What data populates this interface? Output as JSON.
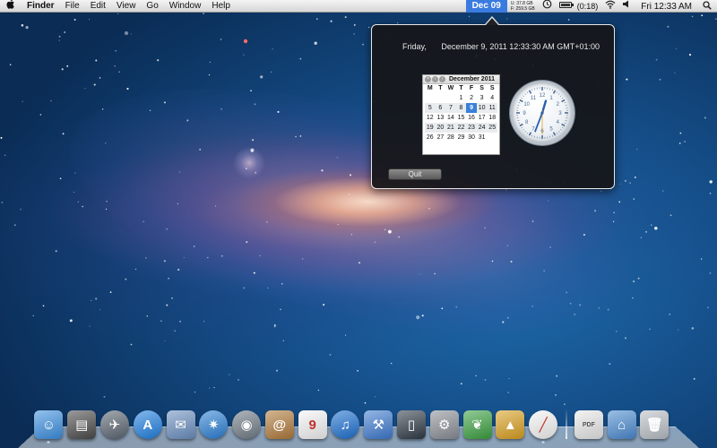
{
  "menubar": {
    "apple_icon": "apple-logo",
    "app_name": "Finder",
    "menus": [
      "File",
      "Edit",
      "View",
      "Go",
      "Window",
      "Help"
    ],
    "status_date": "Dec 09",
    "disk_stats": [
      "U:  37.8 GB",
      "F: 259.5 GB"
    ],
    "icons": [
      "time-machine-icon",
      "battery-icon",
      "wifi-icon",
      "volume-icon",
      "spotlight-icon"
    ],
    "battery_text": "(0:18)",
    "battery_level": 0.85,
    "clock": "Fri 12:33 AM",
    "accent_color": "#3a7be0"
  },
  "popover": {
    "weekday": "Friday,",
    "datetime": "December 9, 2011 12:33:30 AM GMT+01:00",
    "calendar": {
      "title": "December 2011",
      "weekdays": [
        "M",
        "T",
        "W",
        "T",
        "F",
        "S",
        "S"
      ],
      "weeks": [
        [
          "",
          "",
          "",
          "1",
          "2",
          "3",
          "4"
        ],
        [
          "5",
          "6",
          "7",
          "8",
          "9",
          "10",
          "11"
        ],
        [
          "12",
          "13",
          "14",
          "15",
          "16",
          "17",
          "18"
        ],
        [
          "19",
          "20",
          "21",
          "22",
          "23",
          "24",
          "25"
        ],
        [
          "26",
          "27",
          "28",
          "29",
          "30",
          "31",
          ""
        ]
      ],
      "today": "9"
    },
    "clock": {
      "hours": 0,
      "minutes": 33,
      "seconds": 30
    },
    "quit_label": "Quit"
  },
  "dock": {
    "apps": [
      {
        "name": "finder-icon",
        "glyph": "☺",
        "color": "#3b8fe0",
        "running": true
      },
      {
        "name": "dashboard-icon",
        "glyph": "▤",
        "color": "#4a4a4a",
        "running": false
      },
      {
        "name": "launchpad-icon",
        "glyph": "✈",
        "color": "#5a6470",
        "running": false
      },
      {
        "name": "app-store-icon",
        "glyph": "A",
        "color": "#1f7fe0",
        "running": false
      },
      {
        "name": "mail-icon",
        "glyph": "✉",
        "color": "#6b8fc0",
        "running": false
      },
      {
        "name": "safari-icon",
        "glyph": "✷",
        "color": "#2a7fd4",
        "running": false
      },
      {
        "name": "facetime-icon",
        "glyph": "◉",
        "color": "#707a85",
        "running": false
      },
      {
        "name": "address-book-icon",
        "glyph": "@",
        "color": "#b07a3a",
        "running": false
      },
      {
        "name": "ical-icon",
        "glyph": "9",
        "color": "#f4f4f4",
        "running": false
      },
      {
        "name": "itunes-icon",
        "glyph": "♫",
        "color": "#1b6fd0",
        "running": false
      },
      {
        "name": "xcode-icon",
        "glyph": "⚒",
        "color": "#3d7ad0",
        "running": false
      },
      {
        "name": "iphone-simulator-icon",
        "glyph": "▯",
        "color": "#2f3a46",
        "running": false
      },
      {
        "name": "system-preferences-icon",
        "glyph": "⚙",
        "color": "#8a8f96",
        "running": false
      },
      {
        "name": "leaf-icon",
        "glyph": "❦",
        "color": "#3aa040",
        "running": false
      },
      {
        "name": "transmit-icon",
        "glyph": "▲",
        "color": "#d9a020",
        "running": false
      },
      {
        "name": "clock-app-icon",
        "glyph": "╱",
        "color": "#f4f4f4",
        "running": true
      }
    ],
    "stacks": [
      {
        "name": "pdf-document-icon",
        "glyph": "PDF",
        "color": "#e8e8e8"
      },
      {
        "name": "downloads-folder-icon",
        "glyph": "⌂",
        "color": "#4a8ad0"
      },
      {
        "name": "trash-icon",
        "glyph": "🗑",
        "color": "#b9bfc6"
      }
    ]
  }
}
